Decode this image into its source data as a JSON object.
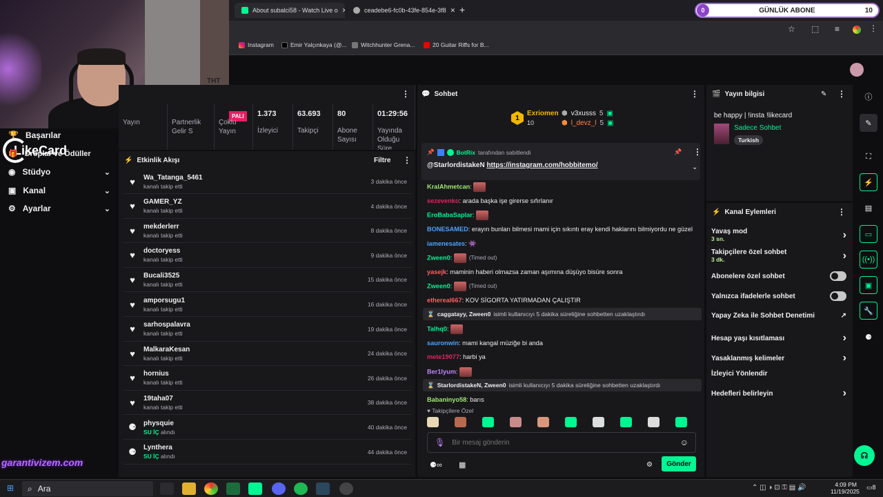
{
  "browser": {
    "tabs": [
      {
        "label": "About subalci58 - Watch Live o"
      },
      {
        "label": "ceadebe6-fc0b-43fe-854e-3f8"
      }
    ],
    "bookmarks": [
      {
        "label": "Instagram"
      },
      {
        "label": "Emir Yalçınkaya (@..."
      },
      {
        "label": "Witchhunter Grena..."
      },
      {
        "label": "20 Guitar Riffs for B..."
      }
    ]
  },
  "overlay": {
    "sub_goal_label": "GÜNLÜK ABONE",
    "sub_goal_current": "0",
    "sub_goal_target": "10",
    "likecard": "LikeCard",
    "watermark": "garantivizem.com",
    "tnt": "TНТ",
    "pali": "PALI"
  },
  "leftnav": {
    "items": [
      {
        "label": "Başarılar"
      },
      {
        "label": "Droplar ve Ödüller"
      },
      {
        "label": "Stüdyo"
      },
      {
        "label": "Kanal"
      },
      {
        "label": "Ayarlar"
      }
    ]
  },
  "stats": {
    "cols": [
      {
        "value": "",
        "label": "Yayın"
      },
      {
        "value": "",
        "label": "Partnerlik Gelir S"
      },
      {
        "value": "",
        "label": "Çoklu Yayın"
      },
      {
        "value": "1.373",
        "label": "İzleyici"
      },
      {
        "value": "63.693",
        "label": "Takipçi"
      },
      {
        "value": "80",
        "label": "Abone Sayısı"
      },
      {
        "value": "01:29:56",
        "label": "Yayında Olduğu Süre"
      }
    ]
  },
  "activity": {
    "title": "Etkinlik Akışı",
    "filter": "Filtre",
    "rows": [
      {
        "name": "Wa_Tatanga_5461",
        "sub": "kanalı takip etti",
        "time": "3 dakika önce",
        "icon": "heart"
      },
      {
        "name": "GAMER_YZ",
        "sub": "kanalı takip etti",
        "time": "4 dakika önce",
        "icon": "heart"
      },
      {
        "name": "mekderlerr",
        "sub": "kanalı takip etti",
        "time": "8 dakika önce",
        "icon": "heart"
      },
      {
        "name": "doctoryess",
        "sub": "kanalı takip etti",
        "time": "9 dakika önce",
        "icon": "heart"
      },
      {
        "name": "Bucali3525",
        "sub": "kanalı takip etti",
        "time": "15 dakika önce",
        "icon": "heart"
      },
      {
        "name": "amporsugu1",
        "sub": "kanalı takip etti",
        "time": "16 dakika önce",
        "icon": "heart"
      },
      {
        "name": "sarhospalavra",
        "sub": "kanalı takip etti",
        "time": "19 dakika önce",
        "icon": "heart"
      },
      {
        "name": "MalkaraKesan",
        "sub": "kanalı takip etti",
        "time": "24 dakika önce",
        "icon": "heart"
      },
      {
        "name": "hornius",
        "sub": "kanalı takip etti",
        "time": "26 dakika önce",
        "icon": "heart"
      },
      {
        "name": "19taha07",
        "sub": "kanalı takip etti",
        "time": "38 dakika önce",
        "icon": "heart"
      },
      {
        "name": "physquie",
        "sub": "SU İÇ",
        "sub2": "alındı",
        "time": "40 dakika önce",
        "icon": "points"
      },
      {
        "name": "Lynthera",
        "sub": "SU İÇ",
        "sub2": "alındı",
        "time": "44 dakika önce",
        "icon": "points"
      }
    ]
  },
  "chat": {
    "title": "Sohbet",
    "leaders": {
      "first_name": "Exriomen",
      "first_count": "10",
      "first_rank": "1",
      "second": [
        {
          "name": "v3xusss",
          "count": "5"
        },
        {
          "name": "l_devz_l",
          "count": "5"
        }
      ]
    },
    "pinned": {
      "by": "BotRix",
      "by_suffix": "tarafından sabitlendi",
      "text_user": "@StarlordistakeN",
      "text_link": "https://instagram.com/hobbitemo/"
    },
    "messages": [
      {
        "user": "KralAhmetcan",
        "color": "#9fe870",
        "text": "",
        "emote": true
      },
      {
        "user": "sezevenko",
        "color": "#e0245e",
        "text": "arada başka işe girerse sıfırlanır"
      },
      {
        "user": "EroBabaSaplar",
        "color": "#00f593",
        "text": "",
        "emote": true
      },
      {
        "user": "BONESAMED",
        "color": "#4aa3ff",
        "text": "erayın bunları bilmesi mami için sıkıntı eray kendi haklarını bilmiyordu ne güzel"
      },
      {
        "user": "iamenesates",
        "color": "#4aa3ff",
        "text": "👾"
      },
      {
        "user": "Zween0",
        "color": "#00f593",
        "text": "(Timed out)",
        "emote": true
      },
      {
        "user": "yasejk",
        "color": "#ff5e5e",
        "text": "maminin haberi olmazsa zaman aşımına düşüyo bisüre sonra"
      },
      {
        "user": "Zween0",
        "color": "#00f593",
        "text": "(Timed out)",
        "emote": true
      },
      {
        "user": "ethereal667",
        "color": "#ff5e5e",
        "text": "KOV SİGORTA YATIRMADAN ÇALIŞTIR"
      },
      {
        "system": "caggatayy, Zween0",
        "system_text": "isimli kullanıcıyı 5 dakika süreliğine sohbetten uzaklaştırdı"
      },
      {
        "user": "Talhq0",
        "color": "#00f593",
        "text": "",
        "emote": true
      },
      {
        "user": "sauronwin",
        "color": "#4aa3ff",
        "text": "mami kangal müziğe bi anda"
      },
      {
        "user": "mete19077",
        "color": "#e0245e",
        "text": "harbi ya"
      },
      {
        "user": "Ber1lyum",
        "color": "#c084fc",
        "text": "",
        "emote": true
      },
      {
        "system": "StarlordistakeN, Zween0",
        "system_text": "isimli kullanıcıyı 5 dakika süreliğine sohbetten uzaklaştırdı"
      },
      {
        "user": "Babaninyo58",
        "color": "#9fe870",
        "text": "barıs"
      }
    ],
    "followers_only": "Takipçilere Özel",
    "input_placeholder": "Bir mesaj gönderin",
    "send": "Gönder"
  },
  "info": {
    "title": "Yayın bilgisi",
    "stream_title": "be happy | !insta !likecard",
    "category": "Sadece Sohbet",
    "tag": "Turkish"
  },
  "actions": {
    "title": "Kanal Eylemleri",
    "items": [
      {
        "label": "Yavaş mod",
        "sub": "3 sn.",
        "control": "chevron"
      },
      {
        "label": "Takipçilere özel sohbet",
        "sub": "3 dk.",
        "control": "chevron"
      },
      {
        "label": "Abonelere özel sohbet",
        "sub": "",
        "control": "toggle"
      },
      {
        "label": "Yalnızca ifadelerle sohbet",
        "sub": "",
        "control": "toggle"
      },
      {
        "label": "Yapay Zeka ile Sohbet Denetimi",
        "sub": "",
        "control": "external"
      },
      {
        "label": "Hesap yaşı kısıtlaması",
        "sub": "",
        "control": "chevron"
      },
      {
        "label": "Yasaklanmış kelimeler",
        "sub": "",
        "control": "chevron"
      },
      {
        "label": "İzleyici Yönlendir",
        "sub": "",
        "control": "none"
      },
      {
        "label": "Hedefleri belirleyin",
        "sub": "",
        "control": "chevron"
      }
    ]
  },
  "taskbar": {
    "search": "Ara",
    "time": "4:09 PM",
    "date": "11/19/2025",
    "notif": "8"
  },
  "colors": {
    "accent": "#00f593",
    "bg": "#0e0e10",
    "panel": "#18181b"
  }
}
